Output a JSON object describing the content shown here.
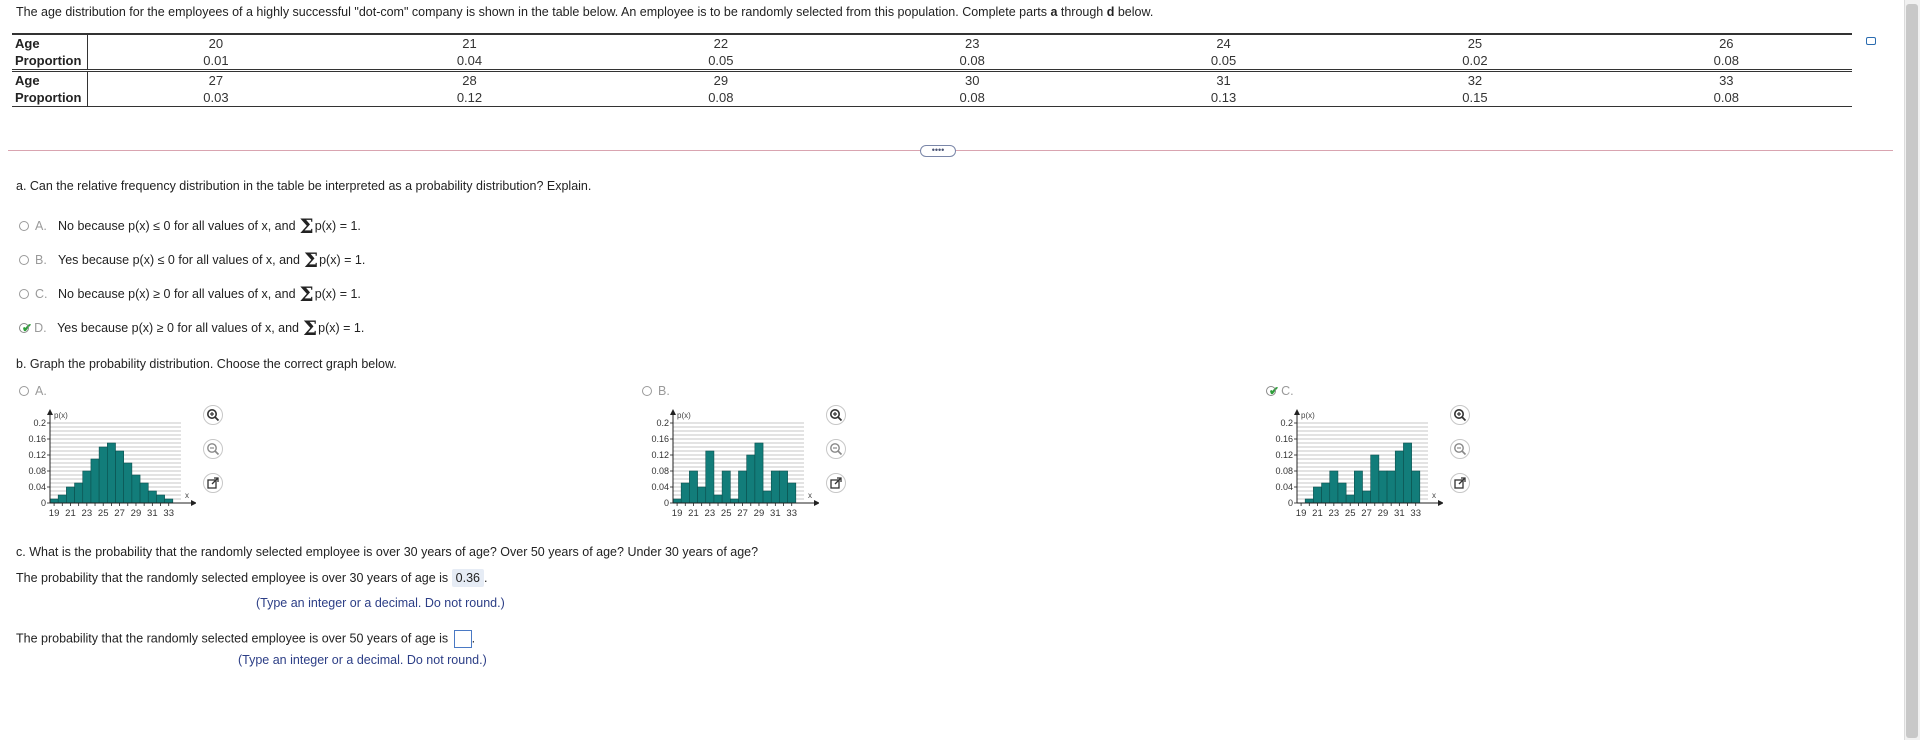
{
  "intro": {
    "text_before": "The age distribution for the employees of a highly successful \"dot-com\" company is shown in the table below. An employee is to be randomly selected from this population. Complete parts ",
    "bold_a": "a",
    "through": " through ",
    "bold_d": "d",
    "text_after": " below."
  },
  "table": {
    "age_label": "Age",
    "proportion_label": "Proportion",
    "row1_ages": [
      "20",
      "21",
      "22",
      "23",
      "24",
      "25",
      "26"
    ],
    "row1_props": [
      "0.01",
      "0.04",
      "0.05",
      "0.08",
      "0.05",
      "0.02",
      "0.08"
    ],
    "row2_ages": [
      "27",
      "28",
      "29",
      "30",
      "31",
      "32",
      "33"
    ],
    "row2_props": [
      "0.03",
      "0.12",
      "0.08",
      "0.08",
      "0.13",
      "0.15",
      "0.08"
    ]
  },
  "expander_label": "••••",
  "part_a": {
    "question": "a. Can the relative frequency distribution in the table be interpreted as a probability distribution? Explain.",
    "options": [
      {
        "letter": "A.",
        "text1": "No because p(x) ≤ 0 for all values of x, and ",
        "sigma": "Σ",
        "text2": "p(x) = 1.",
        "selected": false
      },
      {
        "letter": "B.",
        "text1": "Yes because p(x) ≤ 0 for all values of x, and ",
        "sigma": "Σ",
        "text2": "p(x) = 1.",
        "selected": false
      },
      {
        "letter": "C.",
        "text1": "No because p(x) ≥ 0 for all values of x, and ",
        "sigma": "Σ",
        "text2": "p(x) = 1.",
        "selected": false
      },
      {
        "letter": "D.",
        "text1": "Yes because p(x) ≥ 0 for all values of x, and ",
        "sigma": "Σ",
        "text2": "p(x) = 1.",
        "selected": true
      }
    ],
    "check_mark": "✔"
  },
  "part_b": {
    "question": "b. Graph the probability distribution. Choose the correct graph below.",
    "options": [
      {
        "letter": "A.",
        "selected": false
      },
      {
        "letter": "B.",
        "selected": false
      },
      {
        "letter": "C.",
        "selected": true
      }
    ]
  },
  "chart_data": [
    {
      "type": "bar",
      "option": "A",
      "x": [
        19,
        20,
        21,
        22,
        23,
        24,
        25,
        26,
        27,
        28,
        29,
        30,
        31,
        32,
        33
      ],
      "values": [
        0.01,
        0.02,
        0.04,
        0.05,
        0.08,
        0.11,
        0.14,
        0.15,
        0.13,
        0.1,
        0.07,
        0.05,
        0.03,
        0.02,
        0.01
      ],
      "ylabel": "p(x)",
      "xlabel": "x",
      "yticks": [
        "0.2",
        "0.16",
        "0.12",
        "0.08",
        "0.04",
        "0"
      ],
      "xticks": [
        "19",
        "21",
        "23",
        "25",
        "27",
        "29",
        "31",
        "33"
      ],
      "ylim": [
        0,
        0.2
      ],
      "grid": true
    },
    {
      "type": "bar",
      "option": "B",
      "x": [
        19,
        20,
        21,
        22,
        23,
        24,
        25,
        26,
        27,
        28,
        29,
        30,
        31,
        32,
        33
      ],
      "values": [
        0.01,
        0.05,
        0.08,
        0.04,
        0.13,
        0.02,
        0.08,
        0.01,
        0.08,
        0.12,
        0.15,
        0.03,
        0.08,
        0.08,
        0.05
      ],
      "ylabel": "p(x)",
      "xlabel": "x",
      "yticks": [
        "0.2",
        "0.16",
        "0.12",
        "0.08",
        "0.04",
        "0"
      ],
      "xticks": [
        "19",
        "21",
        "23",
        "25",
        "27",
        "29",
        "31",
        "33"
      ],
      "ylim": [
        0,
        0.2
      ],
      "grid": true
    },
    {
      "type": "bar",
      "option": "C",
      "x": [
        20,
        21,
        22,
        23,
        24,
        25,
        26,
        27,
        28,
        29,
        30,
        31,
        32,
        33
      ],
      "values": [
        0.01,
        0.04,
        0.05,
        0.08,
        0.05,
        0.02,
        0.08,
        0.03,
        0.12,
        0.08,
        0.08,
        0.13,
        0.15,
        0.08
      ],
      "ylabel": "p(x)",
      "xlabel": "x",
      "yticks": [
        "0.2",
        "0.16",
        "0.12",
        "0.08",
        "0.04",
        "0"
      ],
      "xticks": [
        "19",
        "21",
        "23",
        "25",
        "27",
        "29",
        "31",
        "33"
      ],
      "ylim": [
        0,
        0.2
      ],
      "grid": true
    }
  ],
  "part_c": {
    "question": "c. What is the probability that the randomly selected employee is over 30 years of age? Over 50 years of age? Under 30 years of age?",
    "over30_prefix": "The probability that the randomly selected employee is over 30 years of age is ",
    "over30_value": "0.36",
    "over30_suffix": ".",
    "hint": "(Type an integer or a decimal. Do not round.)",
    "over50_prefix": "The probability that the randomly selected employee is over 50 years of age is ",
    "over50_value": "",
    "over50_suffix": ".",
    "hint2": "(Type an integer or a decimal. Do not round.)"
  },
  "colors": {
    "bar": "#127d7a",
    "grid": "#999999",
    "link": "#2c3e86",
    "check": "#2e9e3a"
  }
}
